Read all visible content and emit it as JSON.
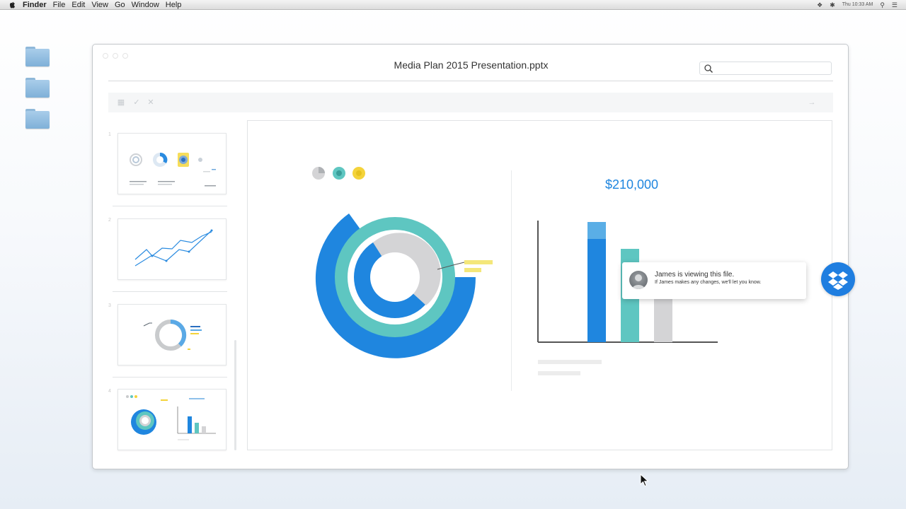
{
  "menubar": {
    "app": "Finder",
    "items": [
      "File",
      "Edit",
      "View",
      "Go",
      "Window",
      "Help"
    ],
    "clock": "Thu 10:33 AM"
  },
  "window": {
    "title": "Media Plan 2015 Presentation.pptx",
    "search_placeholder": ""
  },
  "slide": {
    "amount": "$210,000"
  },
  "notification": {
    "title": "James is viewing this file.",
    "message": "If James makes any changes, we'll let you know."
  },
  "colors": {
    "blue": "#1f86df",
    "teal": "#5ec6c1",
    "gray": "#d4d4d6",
    "yellow": "#f4d33a",
    "dropbox": "#1f7ee0"
  }
}
